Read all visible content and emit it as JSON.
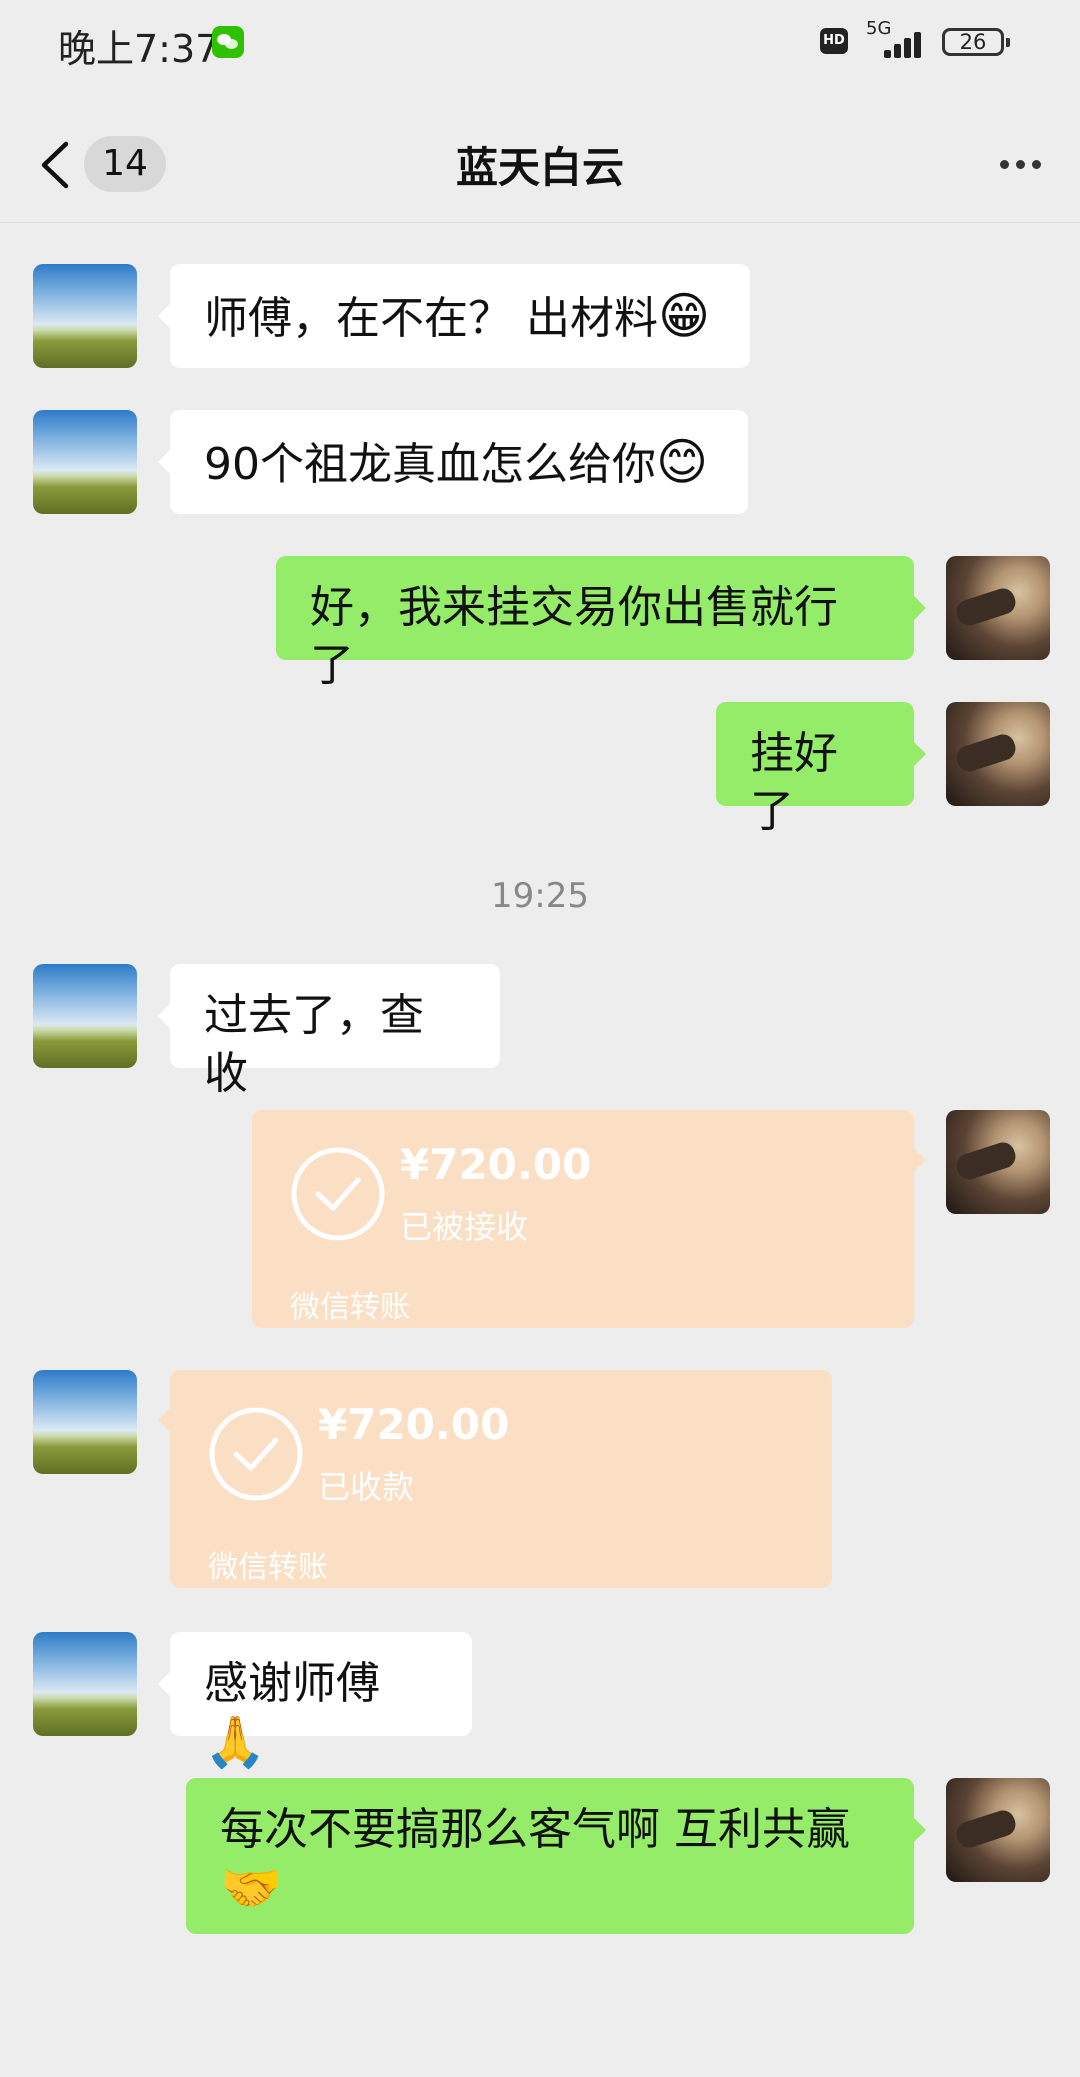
{
  "status_bar": {
    "time": "晚上7:37",
    "hd_label": "HD",
    "network": "5G",
    "battery": "26"
  },
  "header": {
    "unread_count": "14",
    "title": "蓝天白云"
  },
  "messages": [
    {
      "from": "contact",
      "text": "师傅，在不在？ 出材料",
      "emoji": "😁"
    },
    {
      "from": "contact",
      "text": "90个祖龙真血怎么给你",
      "emoji": "😊"
    },
    {
      "from": "self",
      "text": "好，我来挂交易你出售就行了"
    },
    {
      "from": "self",
      "text": "挂好了"
    },
    {
      "from": "contact",
      "text": "过去了，查收"
    },
    {
      "from": "contact",
      "text": "感谢师傅",
      "emoji": "🙏"
    },
    {
      "from": "self",
      "text": "每次不要搞那么客气啊 互利共赢",
      "emoji": "🤝"
    }
  ],
  "timestamp": "19:25",
  "transfers": [
    {
      "from": "self",
      "amount": "¥720.00",
      "status": "已被接收",
      "label": "微信转账"
    },
    {
      "from": "contact",
      "amount": "¥720.00",
      "status": "已收款",
      "label": "微信转账"
    }
  ],
  "colors": {
    "background": "#ededed",
    "incoming_bubble": "#ffffff",
    "outgoing_bubble": "#95ec69",
    "transfer_card": "#fbdfc4"
  },
  "icons": {
    "back": "chevron-left-icon",
    "more": "more-dots-icon",
    "transfer_status": "check-circle-icon"
  }
}
